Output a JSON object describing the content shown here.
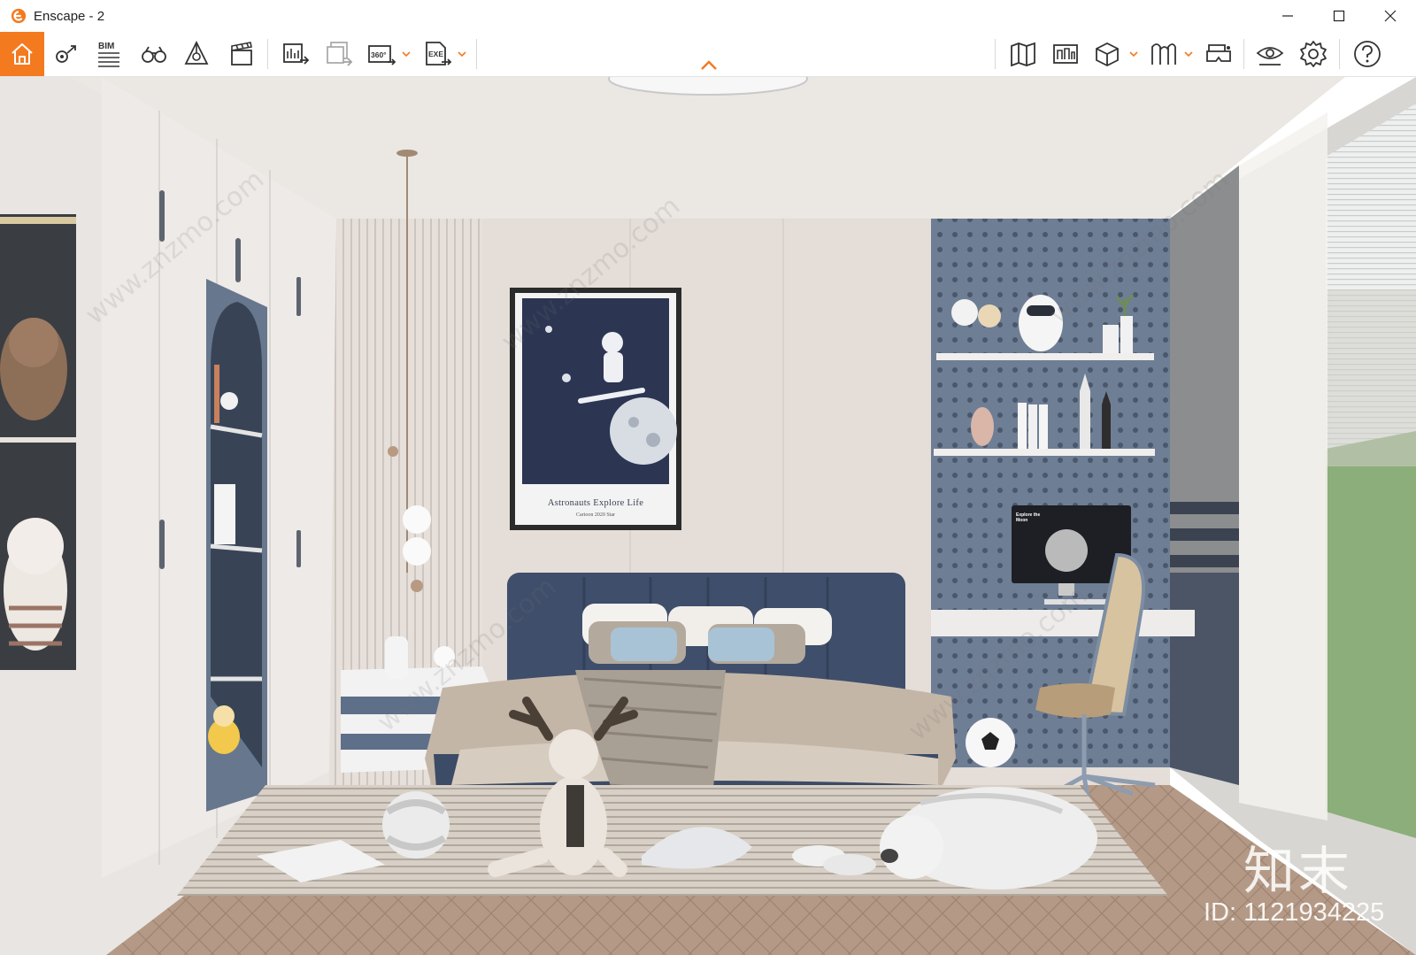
{
  "window": {
    "title": "Enscape - 2",
    "accent_color": "#f47a20"
  },
  "toolbar": {
    "left_tools": [
      {
        "name": "home",
        "icon": "house-icon",
        "active": true
      },
      {
        "name": "views",
        "icon": "location-pin-icon"
      },
      {
        "name": "bim",
        "label": "BIM",
        "icon": "bim-lines-icon"
      },
      {
        "name": "walk-mode",
        "icon": "binoculars-icon"
      },
      {
        "name": "asset-library",
        "icon": "cube-tree-icon"
      },
      {
        "name": "video-editor",
        "icon": "clapperboard-icon"
      },
      {
        "name": "render-image",
        "icon": "render-screen-icon"
      },
      {
        "name": "batch-render",
        "icon": "batch-render-icon"
      },
      {
        "name": "panorama",
        "label": "360°",
        "icon": "panorama-icon"
      },
      {
        "name": "export",
        "label": "EXE",
        "icon": "export-icon"
      }
    ],
    "right_tools": [
      {
        "name": "map",
        "icon": "map-icon"
      },
      {
        "name": "site-context",
        "icon": "building-icon"
      },
      {
        "name": "section",
        "icon": "box-icon"
      },
      {
        "name": "library",
        "icon": "books-icon"
      },
      {
        "name": "vr",
        "icon": "vr-headset-icon"
      },
      {
        "name": "visual-settings",
        "icon": "eye-icon"
      },
      {
        "name": "settings",
        "icon": "gear-icon"
      },
      {
        "name": "help",
        "icon": "question-icon"
      }
    ]
  },
  "viewport": {
    "poster": {
      "title": "Astronauts Explore Life",
      "subtitle": "Cartoon 2020 Star"
    },
    "monitor_text": "Explore the Moon",
    "watermarks": {
      "logo": "知末",
      "id": "ID: 1121934225",
      "diagonal": "www.znzmo.com"
    }
  }
}
